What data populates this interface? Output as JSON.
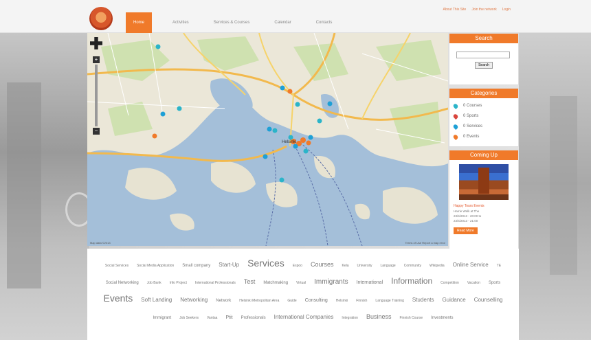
{
  "nav": {
    "items": [
      {
        "label": "Home",
        "active": true
      },
      {
        "label": "Activities",
        "active": false
      },
      {
        "label": "Services & Courses",
        "active": false
      },
      {
        "label": "Calendar",
        "active": false
      },
      {
        "label": "Contacts",
        "active": false
      }
    ],
    "top_links": [
      "About This Site",
      "Join the network",
      "Login"
    ]
  },
  "map": {
    "city_label": "Helsinki",
    "attribution": "Map data ©2013",
    "copyright": "Terms of Use  Report a map error"
  },
  "search": {
    "title": "Search",
    "placeholder": "",
    "button_label": "Search"
  },
  "categories": {
    "title": "Categories",
    "items": [
      {
        "label": "0 Courses",
        "color": "#2bb4c9"
      },
      {
        "label": "0 Sports",
        "color": "#d9453d"
      },
      {
        "label": "0 Services",
        "color": "#1ea0d6"
      },
      {
        "label": "0 Events",
        "color": "#f07a2a"
      }
    ]
  },
  "coming_up": {
    "title": "Coming Up",
    "event_title": "Happy Tours Events",
    "lines": [
      "Harrie Walk at The",
      "23/4/2013 - 20:00 to",
      "23/4/2013 - 21:00"
    ],
    "button_label": "Read More"
  },
  "tag_cloud": {
    "tags": [
      {
        "label": "Social Services",
        "size": 5
      },
      {
        "label": "Social Media Application",
        "size": 5
      },
      {
        "label": "Small company",
        "size": 6
      },
      {
        "label": "Start-Up",
        "size": 8
      },
      {
        "label": "Services",
        "size": 14
      },
      {
        "label": "Espoo",
        "size": 5
      },
      {
        "label": "Courses",
        "size": 9
      },
      {
        "label": "Kela",
        "size": 5
      },
      {
        "label": "University",
        "size": 5
      },
      {
        "label": "Language",
        "size": 5
      },
      {
        "label": "Community",
        "size": 5
      },
      {
        "label": "Wikipedia",
        "size": 5
      },
      {
        "label": "Online Service",
        "size": 8
      },
      {
        "label": "TE",
        "size": 5
      },
      {
        "label": "Social Networking",
        "size": 6
      },
      {
        "label": "Job Bank",
        "size": 5
      },
      {
        "label": "Info Project",
        "size": 5
      },
      {
        "label": "International Professionals",
        "size": 5
      },
      {
        "label": "Test",
        "size": 9
      },
      {
        "label": "Matchmaking",
        "size": 6
      },
      {
        "label": "Virtual",
        "size": 5
      },
      {
        "label": "Immigrants",
        "size": 10
      },
      {
        "label": "International",
        "size": 7
      },
      {
        "label": "Information",
        "size": 12
      },
      {
        "label": "Competition",
        "size": 5
      },
      {
        "label": "Vacation",
        "size": 5
      },
      {
        "label": "Sports",
        "size": 6
      },
      {
        "label": "Events",
        "size": 14
      },
      {
        "label": "Soft Landing",
        "size": 8
      },
      {
        "label": "Networking",
        "size": 8
      },
      {
        "label": "Network",
        "size": 6
      },
      {
        "label": "Helsinki Metropolitan Area",
        "size": 5
      },
      {
        "label": "Guide",
        "size": 5
      },
      {
        "label": "Consulting",
        "size": 7
      },
      {
        "label": "Helsinki",
        "size": 5
      },
      {
        "label": "Finnish",
        "size": 5
      },
      {
        "label": "Language Training",
        "size": 5
      },
      {
        "label": "Students",
        "size": 8
      },
      {
        "label": "Guidance",
        "size": 8
      },
      {
        "label": "Counselling",
        "size": 8
      },
      {
        "label": "Immigrant",
        "size": 6
      },
      {
        "label": "Job Seekers",
        "size": 5
      },
      {
        "label": "Vantaa",
        "size": 5
      },
      {
        "label": "Ptit",
        "size": 7
      },
      {
        "label": "Professionals",
        "size": 6
      },
      {
        "label": "International Companies",
        "size": 8
      },
      {
        "label": "Integration",
        "size": 5
      },
      {
        "label": "Business",
        "size": 9
      },
      {
        "label": "Finnish Course",
        "size": 5
      },
      {
        "label": "Investments",
        "size": 6
      }
    ]
  }
}
